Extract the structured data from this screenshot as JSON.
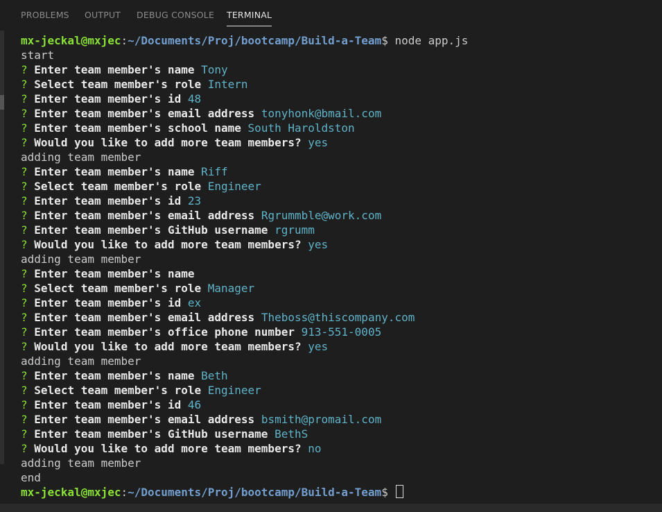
{
  "tabs": [
    {
      "label": "PROBLEMS"
    },
    {
      "label": "OUTPUT"
    },
    {
      "label": "DEBUG CONSOLE"
    },
    {
      "label": "TERMINAL"
    }
  ],
  "prompt": {
    "user_host": "mx-jeckal@mxjec",
    "colon": ":",
    "path": "~/Documents/Proj/bootcamp/Build-a-Team",
    "dollar": "$",
    "command": " node app.js"
  },
  "lines": [
    {
      "type": "prompt"
    },
    {
      "type": "plain",
      "text": "start"
    },
    {
      "type": "q",
      "question": "Enter team member's name",
      "answer": "Tony"
    },
    {
      "type": "q",
      "question": "Select team member's role",
      "answer": "Intern"
    },
    {
      "type": "q",
      "question": "Enter team member's id",
      "answer": "48"
    },
    {
      "type": "q",
      "question": "Enter team member's email address",
      "answer": "tonyhonk@bmail.com"
    },
    {
      "type": "q",
      "question": "Enter team member's school name",
      "answer": "South Haroldston"
    },
    {
      "type": "q",
      "question": "Would you like to add more team members?",
      "answer": "yes"
    },
    {
      "type": "plain",
      "text": "adding team member"
    },
    {
      "type": "q",
      "question": "Enter team member's name",
      "answer": "Riff"
    },
    {
      "type": "q",
      "question": "Select team member's role",
      "answer": "Engineer"
    },
    {
      "type": "q",
      "question": "Enter team member's id",
      "answer": "23"
    },
    {
      "type": "q",
      "question": "Enter team member's email address",
      "answer": "Rgrummble@work.com"
    },
    {
      "type": "q",
      "question": "Enter team member's GitHub username",
      "answer": "rgrumm"
    },
    {
      "type": "q",
      "question": "Would you like to add more team members?",
      "answer": "yes"
    },
    {
      "type": "plain",
      "text": "adding team member"
    },
    {
      "type": "q",
      "question": "Enter team member's name",
      "answer": ""
    },
    {
      "type": "q",
      "question": "Select team member's role",
      "answer": "Manager"
    },
    {
      "type": "q",
      "question": "Enter team member's id",
      "answer": "ex"
    },
    {
      "type": "q",
      "question": "Enter team member's email address",
      "answer": "Theboss@thiscompany.com"
    },
    {
      "type": "q",
      "question": "Enter team member's office phone number",
      "answer": "913-551-0005"
    },
    {
      "type": "q",
      "question": "Would you like to add more team members?",
      "answer": "yes"
    },
    {
      "type": "plain",
      "text": "adding team member"
    },
    {
      "type": "q",
      "question": "Enter team member's name",
      "answer": "Beth"
    },
    {
      "type": "q",
      "question": "Select team member's role",
      "answer": "Engineer"
    },
    {
      "type": "q",
      "question": "Enter team member's id",
      "answer": "46"
    },
    {
      "type": "q",
      "question": "Enter team member's email address",
      "answer": "bsmith@promail.com"
    },
    {
      "type": "q",
      "question": "Enter team member's GitHub username",
      "answer": "BethS"
    },
    {
      "type": "q",
      "question": "Would you like to add more team members?",
      "answer": "no"
    },
    {
      "type": "plain",
      "text": "adding team member"
    },
    {
      "type": "plain",
      "text": "end"
    },
    {
      "type": "prompt_final"
    }
  ],
  "q_mark": "?",
  "colors": {
    "background": "#1e1e1e",
    "prompt_user": "#8ae234",
    "prompt_path": "#729fcf",
    "question_mark": "#8ae234",
    "answer": "#5fb3c9",
    "text": "#cccccc"
  }
}
